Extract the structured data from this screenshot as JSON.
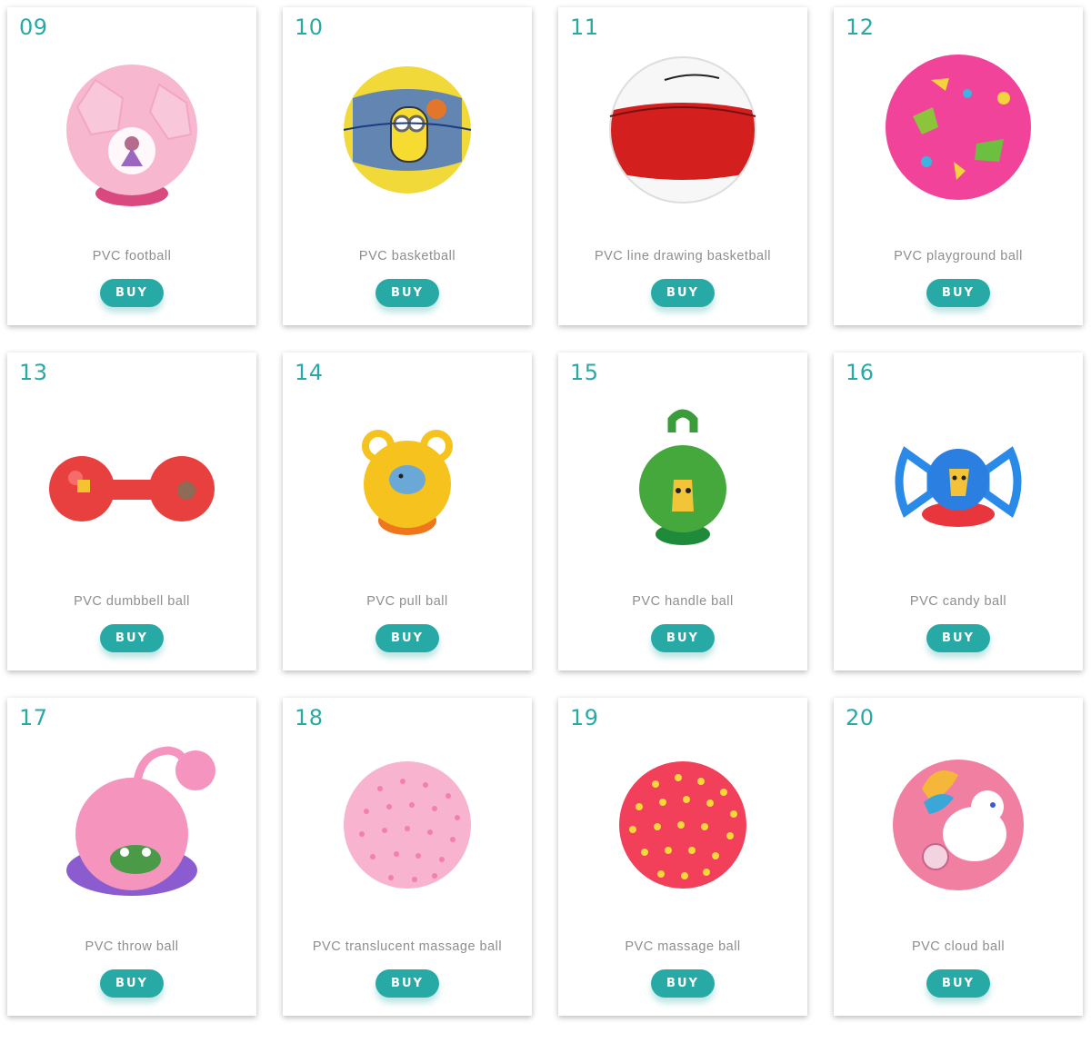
{
  "products": [
    {
      "number": "09",
      "name": "PVC football",
      "buy_label": "BUY"
    },
    {
      "number": "10",
      "name": "PVC basketball",
      "buy_label": "BUY"
    },
    {
      "number": "11",
      "name": "PVC line drawing basketball",
      "buy_label": "BUY"
    },
    {
      "number": "12",
      "name": "PVC playground ball",
      "buy_label": "BUY"
    },
    {
      "number": "13",
      "name": "PVC dumbbell ball",
      "buy_label": "BUY"
    },
    {
      "number": "14",
      "name": "PVC pull ball",
      "buy_label": "BUY"
    },
    {
      "number": "15",
      "name": "PVC handle ball",
      "buy_label": "BUY"
    },
    {
      "number": "16",
      "name": "PVC candy ball",
      "buy_label": "BUY"
    },
    {
      "number": "17",
      "name": "PVC throw ball",
      "buy_label": "BUY"
    },
    {
      "number": "18",
      "name": "PVC translucent massage ball",
      "buy_label": "BUY"
    },
    {
      "number": "19",
      "name": "PVC massage ball",
      "buy_label": "BUY"
    },
    {
      "number": "20",
      "name": "PVC cloud ball",
      "buy_label": "BUY"
    }
  ],
  "colors": {
    "accent": "#27aaa6",
    "label": "#8e8e8e",
    "card_bg": "#ffffff"
  }
}
